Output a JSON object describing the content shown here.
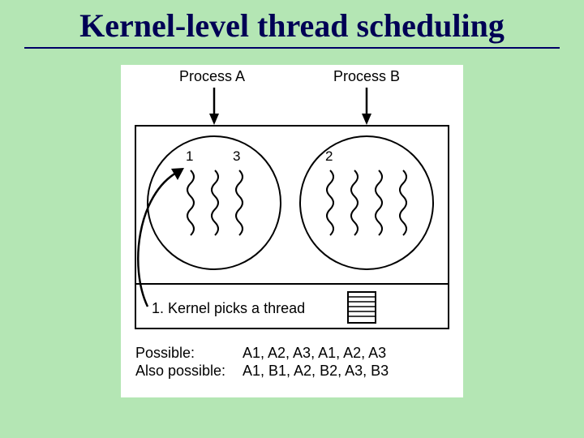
{
  "title": "Kernel-level thread scheduling",
  "labels": {
    "process_a": "Process A",
    "process_b": "Process B",
    "thread_a1": "1",
    "thread_a3": "3",
    "thread_b2": "2",
    "caption": "1. Kernel picks a thread"
  },
  "footer": {
    "possible_label": "Possible:",
    "possible_seq": "A1, A2, A3, A1, A2, A3",
    "also_possible_label": "Also possible:",
    "also_possible_seq": "A1, B1, A2, B2, A3, B3"
  }
}
